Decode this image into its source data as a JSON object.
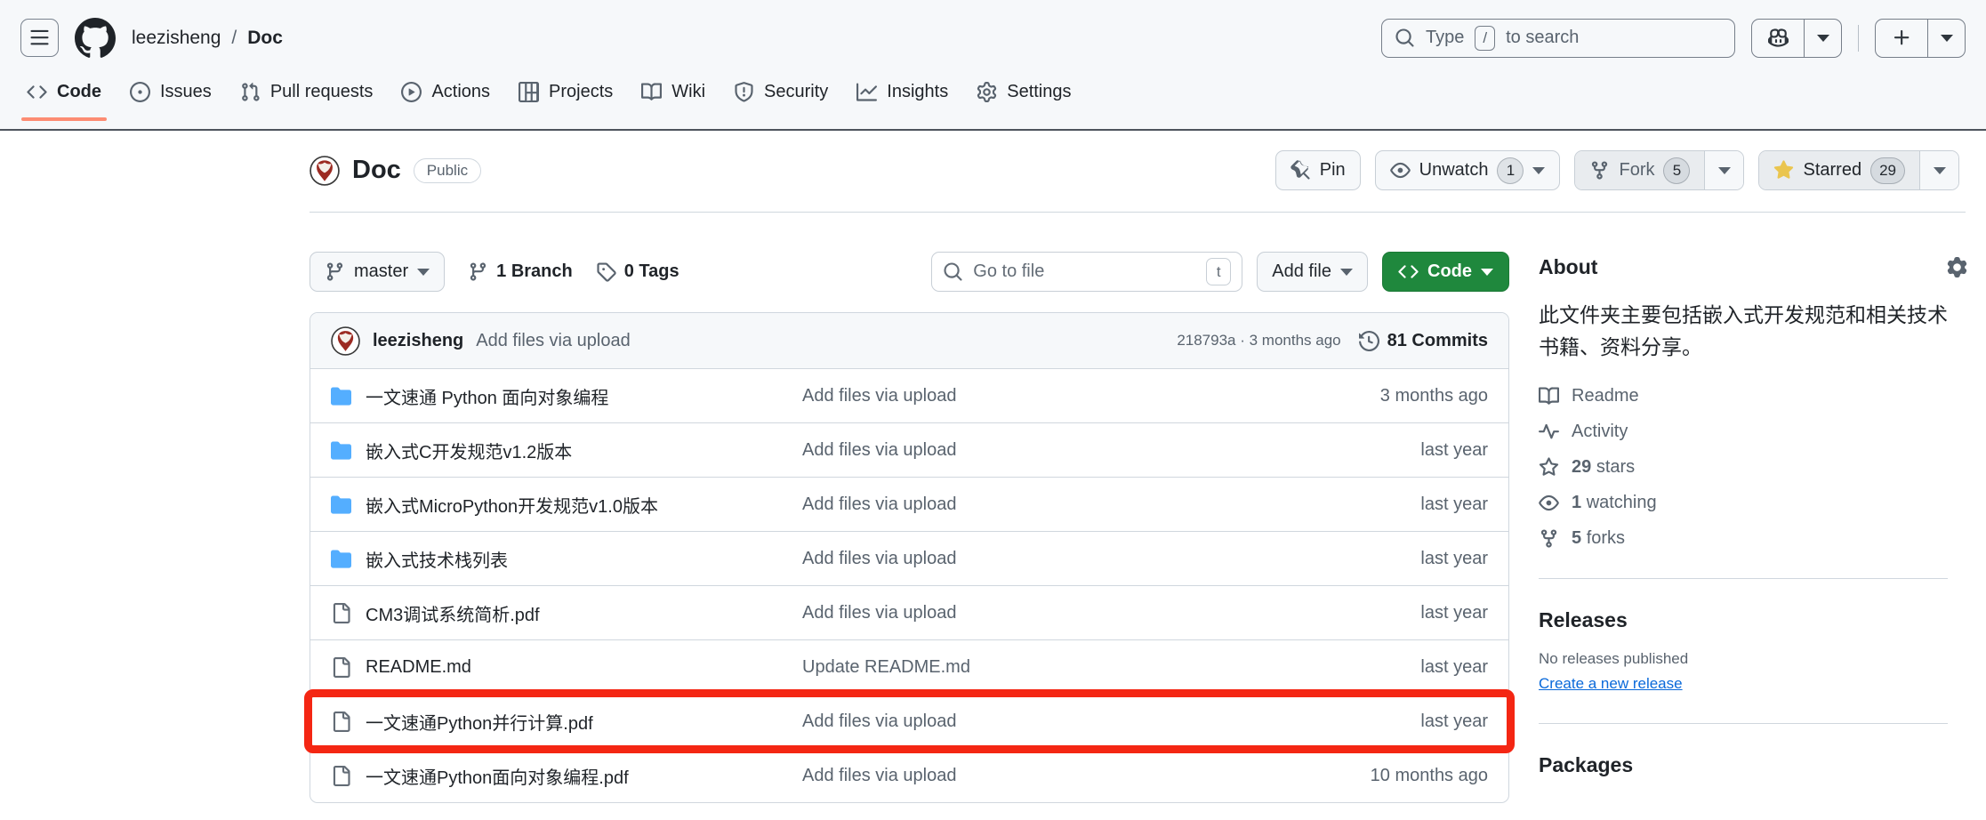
{
  "colors": {
    "header_bg": "#f6f8fa",
    "accent_green": "#1f883d",
    "folder_blue": "#54aeff",
    "star_gold": "#eac54f",
    "tab_underline": "#fd8c73",
    "link_blue": "#0969da",
    "annotation_red": "#f42613"
  },
  "header": {
    "owner": "leezisheng",
    "separator": "/",
    "repo": "Doc",
    "search_prefix": "Type",
    "search_key": "/",
    "search_suffix": "to search"
  },
  "nav": {
    "tabs": [
      {
        "label": "Code",
        "active": true
      },
      {
        "label": "Issues"
      },
      {
        "label": "Pull requests"
      },
      {
        "label": "Actions"
      },
      {
        "label": "Projects"
      },
      {
        "label": "Wiki"
      },
      {
        "label": "Security"
      },
      {
        "label": "Insights"
      },
      {
        "label": "Settings"
      }
    ]
  },
  "repo": {
    "title": "Doc",
    "visibility": "Public",
    "pin_label": "Pin",
    "watch_label": "Unwatch",
    "watch_count": "1",
    "fork_label": "Fork",
    "fork_count": "5",
    "star_label": "Starred",
    "star_count": "29"
  },
  "toolbar": {
    "branch": "master",
    "branches_count": "1",
    "branches_label": "Branch",
    "tags_count": "0",
    "tags_label": "Tags",
    "goto_placeholder": "Go to file",
    "goto_key": "t",
    "add_file_label": "Add file",
    "code_label": "Code"
  },
  "commit_bar": {
    "author": "leezisheng",
    "message": "Add files via upload",
    "meta": "218793a · 3 months ago",
    "commits_label": "81 Commits"
  },
  "files": [
    {
      "type": "folder",
      "name": "一文速通 Python 面向对象编程",
      "message": "Add files via upload",
      "date": "3 months ago"
    },
    {
      "type": "folder",
      "name": "嵌入式C开发规范v1.2版本",
      "message": "Add files via upload",
      "date": "last year"
    },
    {
      "type": "folder",
      "name": "嵌入式MicroPython开发规范v1.0版本",
      "message": "Add files via upload",
      "date": "last year"
    },
    {
      "type": "folder",
      "name": "嵌入式技术栈列表",
      "message": "Add files via upload",
      "date": "last year"
    },
    {
      "type": "file",
      "name": "CM3调试系统简析.pdf",
      "message": "Add files via upload",
      "date": "last year"
    },
    {
      "type": "file",
      "name": "README.md",
      "message": "Update README.md",
      "date": "last year"
    },
    {
      "type": "file",
      "name": "一文速通Python并行计算.pdf",
      "message": "Add files via upload",
      "date": "last year",
      "highlighted": true
    },
    {
      "type": "file",
      "name": "一文速通Python面向对象编程.pdf",
      "message": "Add files via upload",
      "date": "10 months ago"
    }
  ],
  "sidebar": {
    "about": {
      "title": "About",
      "description": "此文件夹主要包括嵌入式开发规范和相关技术书籍、资料分享。",
      "readme_label": "Readme",
      "activity_label": "Activity",
      "stars_count": "29",
      "stars_label": "stars",
      "watching_count": "1",
      "watching_label": "watching",
      "forks_count": "5",
      "forks_label": "forks"
    },
    "releases": {
      "title": "Releases",
      "empty": "No releases published",
      "link": "Create a new release"
    },
    "packages": {
      "title": "Packages"
    }
  }
}
